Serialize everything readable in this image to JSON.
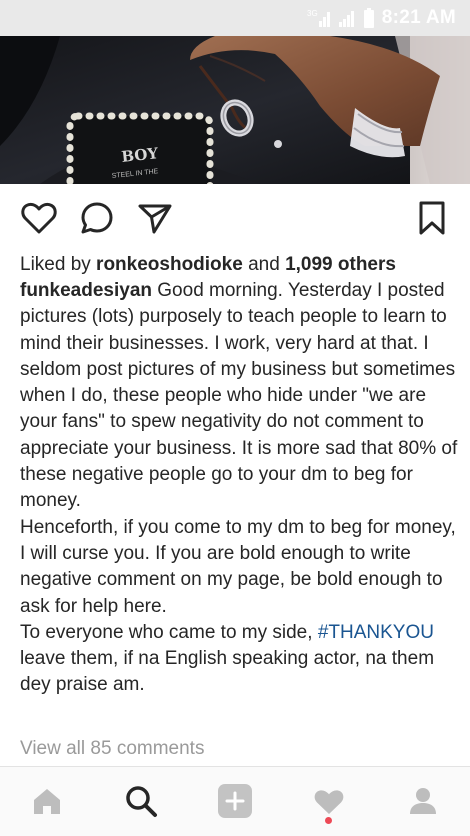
{
  "status_bar": {
    "network": "3G",
    "time": "8:21 AM"
  },
  "post": {
    "image": {
      "text_line1": "BOY",
      "text_line2": "STEEL IN THE"
    },
    "likes": {
      "prefix": "Liked by ",
      "user": "ronkeoshodioke",
      "middle": " and ",
      "others": "1,099 others"
    },
    "caption": {
      "username": "funkeadesiyan",
      "text_part1": " Good morning. Yesterday I posted pictures (lots) purposely to teach people to learn to mind their businesses. I work, very hard at that. I seldom post pictures of my business but sometimes when I do, these people who hide under \"we are your fans\" to spew negativity do not comment to appreciate your business. It is more sad that 80% of these negative people go to your dm to beg for money.\nHenceforth, if you come to my dm to beg for money, I will curse you. If you are bold enough to write negative comment on my page, be bold enough to ask for help here.\nTo everyone who came to my side, ",
      "hashtag": "#THANKYOU",
      "text_part2": " leave them, if na English speaking actor, na them dey praise am."
    },
    "view_comments": "View all 85 comments"
  },
  "icons": {
    "like": "heart-outline-icon",
    "comment": "comment-bubble-icon",
    "share": "paper-plane-icon",
    "save": "bookmark-icon"
  },
  "nav": {
    "items": [
      "home-icon",
      "search-icon",
      "add-post-icon",
      "activity-heart-icon",
      "profile-icon"
    ]
  },
  "colors": {
    "text": "#262626",
    "hashtag": "#1a5591",
    "muted": "#9a9a9a",
    "nav_icon": "#bdbdbd",
    "notification_dot": "#ed4956"
  }
}
